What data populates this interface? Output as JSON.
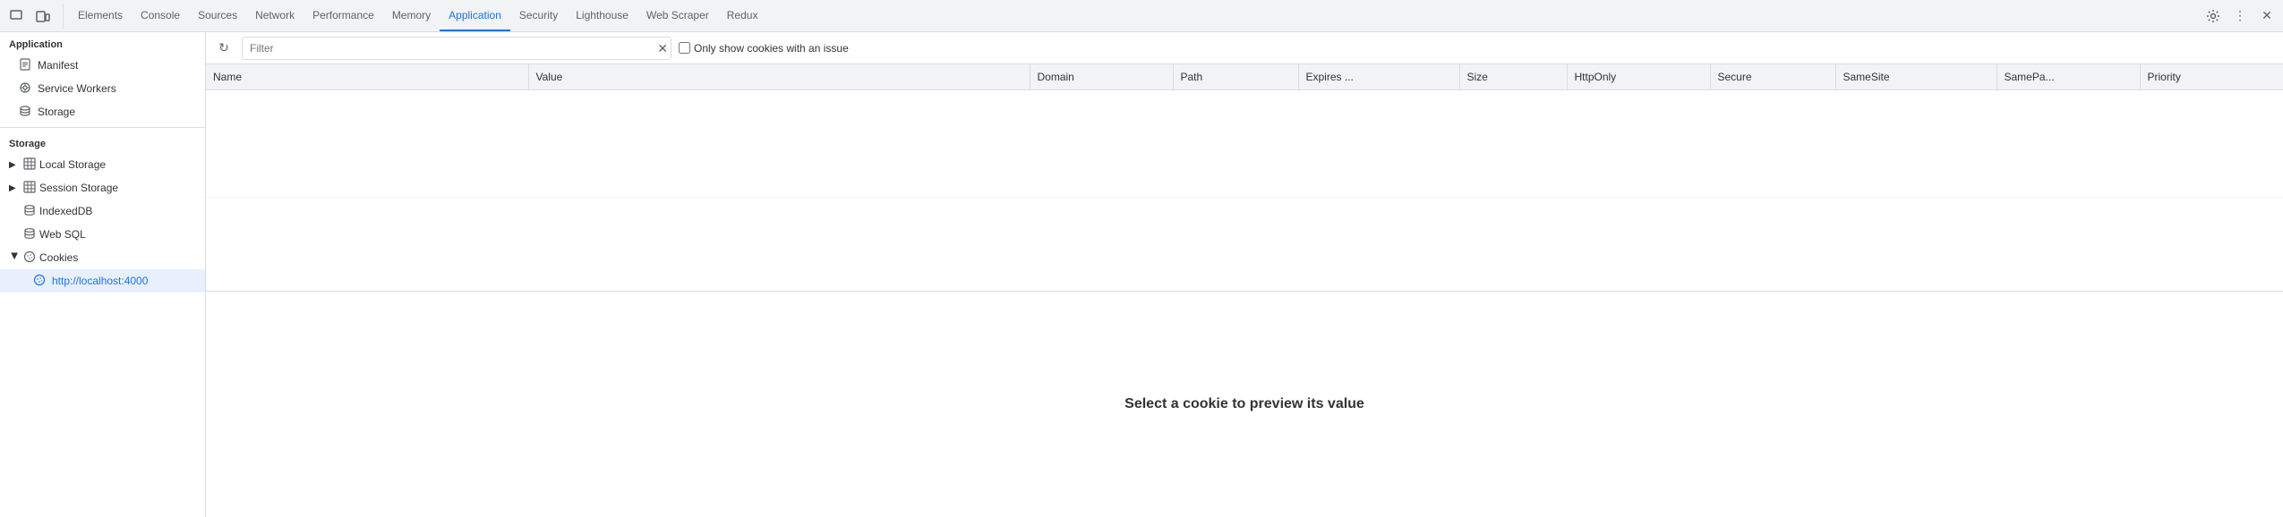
{
  "tabs": [
    {
      "id": "elements",
      "label": "Elements",
      "active": false
    },
    {
      "id": "console",
      "label": "Console",
      "active": false
    },
    {
      "id": "sources",
      "label": "Sources",
      "active": false
    },
    {
      "id": "network",
      "label": "Network",
      "active": false
    },
    {
      "id": "performance",
      "label": "Performance",
      "active": false
    },
    {
      "id": "memory",
      "label": "Memory",
      "active": false
    },
    {
      "id": "application",
      "label": "Application",
      "active": true
    },
    {
      "id": "security",
      "label": "Security",
      "active": false
    },
    {
      "id": "lighthouse",
      "label": "Lighthouse",
      "active": false
    },
    {
      "id": "webscraper",
      "label": "Web Scraper",
      "active": false
    },
    {
      "id": "redux",
      "label": "Redux",
      "active": false
    }
  ],
  "sidebar": {
    "application_header": "Application",
    "storage_header": "Storage",
    "app_items": [
      {
        "id": "manifest",
        "label": "Manifest",
        "icon": "📄"
      },
      {
        "id": "service_workers",
        "label": "Service Workers",
        "icon": "⚙"
      },
      {
        "id": "storage",
        "label": "Storage",
        "icon": "💾"
      }
    ],
    "storage_items": [
      {
        "id": "local_storage",
        "label": "Local Storage",
        "icon": "grid",
        "expandable": true,
        "expanded": false
      },
      {
        "id": "session_storage",
        "label": "Session Storage",
        "icon": "grid",
        "expandable": true,
        "expanded": false
      },
      {
        "id": "indexeddb",
        "label": "IndexedDB",
        "icon": "cylinder",
        "expandable": false
      },
      {
        "id": "web_sql",
        "label": "Web SQL",
        "icon": "cylinder",
        "expandable": false
      },
      {
        "id": "cookies",
        "label": "Cookies",
        "icon": "globe",
        "expandable": true,
        "expanded": true
      }
    ],
    "cookie_children": [
      {
        "id": "localhost4000",
        "label": "http://localhost:4000",
        "active": true
      }
    ]
  },
  "filter": {
    "placeholder": "Filter",
    "value": "",
    "checkbox_label": "Only show cookies with an issue",
    "checkbox_checked": false
  },
  "table": {
    "columns": [
      "Name",
      "Value",
      "Domain",
      "Path",
      "Expires ...",
      "Size",
      "HttpOnly",
      "Secure",
      "SameSite",
      "SamePa...",
      "Priority"
    ],
    "rows": []
  },
  "preview": {
    "text": "Select a cookie to preview its value"
  },
  "icons": {
    "cursor": "⬜",
    "inspect": "📦",
    "settings": "⚙",
    "more": "⋮",
    "close": "✕",
    "refresh": "↻",
    "clear": "✕"
  }
}
